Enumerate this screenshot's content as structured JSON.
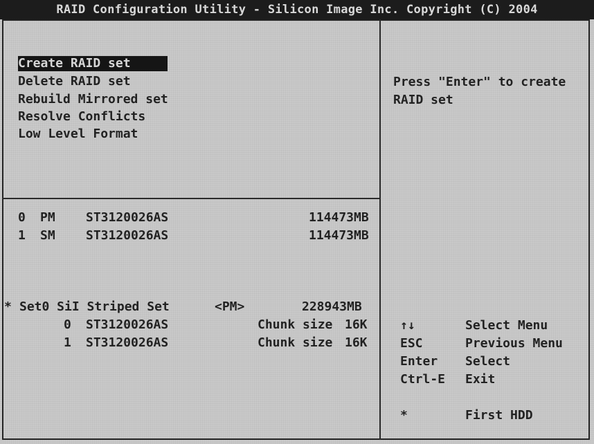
{
  "title": "RAID Configuration Utility - Silicon Image Inc. Copyright (C) 2004",
  "menu": [
    {
      "label": "Create RAID set",
      "selected": true
    },
    {
      "label": "Delete RAID set",
      "selected": false
    },
    {
      "label": "Rebuild Mirrored set",
      "selected": false
    },
    {
      "label": "Resolve Conflicts",
      "selected": false
    },
    {
      "label": "Low Level Format",
      "selected": false
    }
  ],
  "help_text": "Press \"Enter\" to create RAID set",
  "drives": [
    {
      "index": "0",
      "role": "PM",
      "model": "ST3120026AS",
      "size": "114473MB"
    },
    {
      "index": "1",
      "role": "SM",
      "model": "ST3120026AS",
      "size": "114473MB"
    }
  ],
  "raid_set": {
    "marker": "*",
    "name": "Set0 SiI Striped Set",
    "role": "<PM>",
    "size": "228943MB",
    "members": [
      {
        "index": "0",
        "model": "ST3120026AS",
        "chunk_label": "Chunk size",
        "chunk": "16K"
      },
      {
        "index": "1",
        "model": "ST3120026AS",
        "chunk_label": "Chunk size",
        "chunk": "16K"
      }
    ]
  },
  "keys": [
    {
      "key": "↑↓",
      "action": "Select Menu"
    },
    {
      "key": "ESC",
      "action": "Previous Menu"
    },
    {
      "key": "Enter",
      "action": "Select"
    },
    {
      "key": "Ctrl-E",
      "action": "Exit"
    }
  ],
  "legend": {
    "key": "*",
    "action": "First HDD"
  }
}
